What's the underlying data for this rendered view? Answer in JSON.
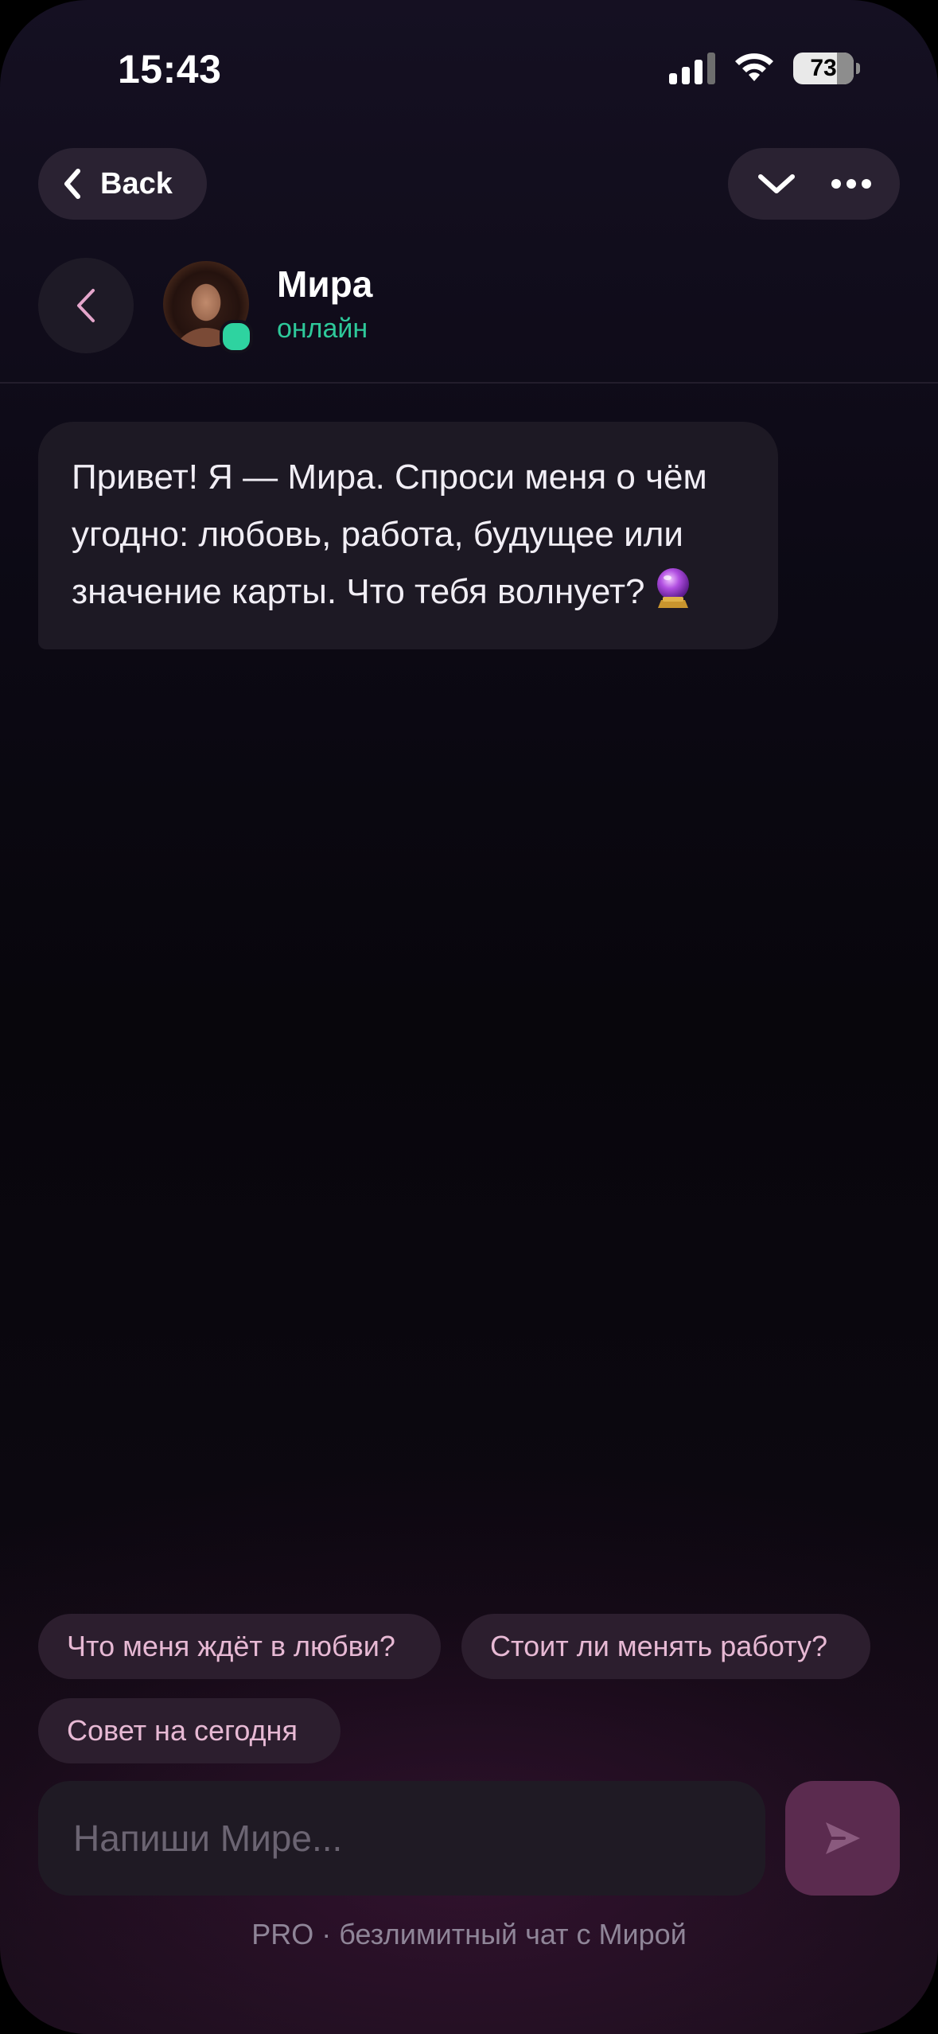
{
  "status_bar": {
    "time": "15:43",
    "battery_level": "73",
    "battery_fraction": 0.73
  },
  "nav": {
    "back_label": "Back",
    "icons": [
      "chevron-left-icon",
      "chevron-down-icon",
      "more-horizontal-icon"
    ]
  },
  "contact": {
    "name": "Мира",
    "status": "онлайн",
    "status_color": "#2ec99a"
  },
  "messages": [
    {
      "sender": "Мира",
      "text": "Привет! Я — Мира. Спроси меня о чём угодно: любовь, работа, будущее или значение карты. Что тебя волнует?",
      "emoji_icon": "crystal-ball-icon"
    }
  ],
  "suggestions": [
    "Что меня ждёт в любви?",
    "Стоит ли менять работу?",
    "Совет на сегодня"
  ],
  "composer": {
    "placeholder": "Напиши Мире...",
    "send_icon": "send-icon"
  },
  "footer": {
    "note": "PRO · безлимитный чат с Мирой"
  },
  "colors": {
    "accent_pink": "#e7b9d4",
    "chip_bg": "#2c1e2e",
    "send_bg": "#5b2b4f",
    "online_green": "#2ed3a0"
  }
}
